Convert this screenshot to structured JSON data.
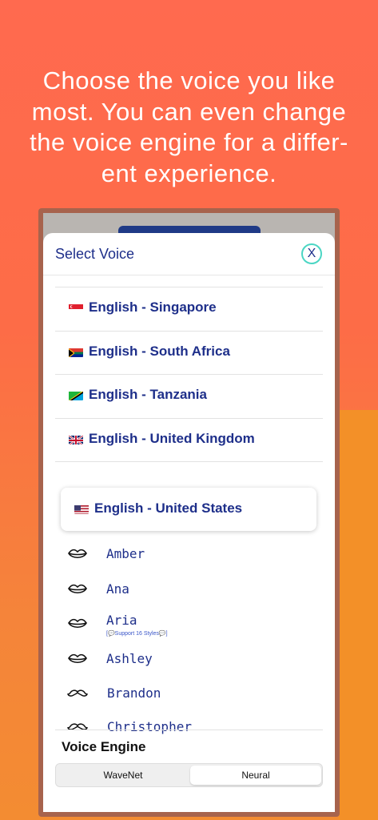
{
  "headline": {
    "line1": "Choose the voice you like",
    "line2": "most. You can even change",
    "line3": "the voice engine for a differ-",
    "line4": "ent experience."
  },
  "colors": {
    "background_top": "#ff6a4f",
    "background_bottom": "#f38c32",
    "accent_navy": "#1e2f8a",
    "close_ring": "#4bd6c4"
  },
  "sheet": {
    "title": "Select Voice",
    "close_label": "X"
  },
  "languages": [
    {
      "label": "English - Singapore",
      "flag": "flag-singapore-icon"
    },
    {
      "label": "English - South Africa",
      "flag": "flag-south-africa-icon"
    },
    {
      "label": "English - Tanzania",
      "flag": "flag-tanzania-icon"
    },
    {
      "label": "English - United Kingdom",
      "flag": "flag-united-kingdom-icon"
    }
  ],
  "selected_language": {
    "label": "English - United States",
    "flag": "flag-united-states-icon"
  },
  "voices": [
    {
      "name": "Amber",
      "icon": "lips-icon"
    },
    {
      "name": "Ana",
      "icon": "lips-icon"
    },
    {
      "name": "Aria",
      "icon": "lips-icon",
      "note": "[💬Support 16 Styles💬]"
    },
    {
      "name": "Ashley",
      "icon": "lips-icon"
    },
    {
      "name": "Brandon",
      "icon": "mustache-icon"
    },
    {
      "name": "Christopher",
      "icon": "mustache-icon"
    }
  ],
  "voice_engine": {
    "label": "Voice Engine",
    "options": [
      "WaveNet",
      "Neural"
    ],
    "selected": "Neural"
  }
}
